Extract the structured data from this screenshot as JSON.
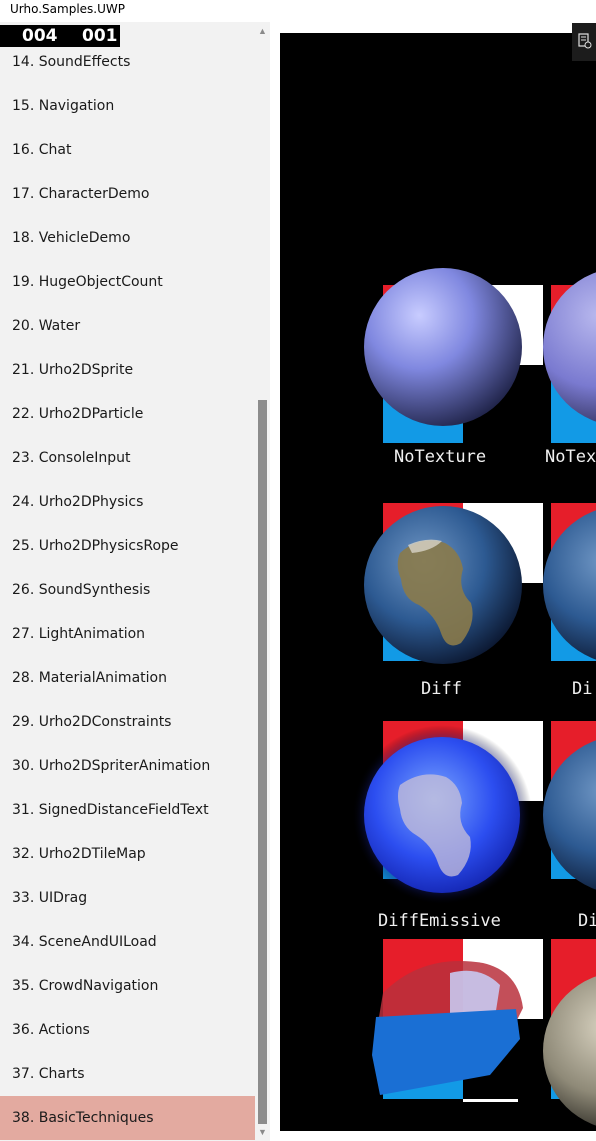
{
  "window": {
    "title": "Urho.Samples.UWP"
  },
  "fps": {
    "left": "004",
    "right": "001"
  },
  "samples": [
    "14. SoundEffects",
    "15. Navigation",
    "16. Chat",
    "17. CharacterDemo",
    "18. VehicleDemo",
    "19. HugeObjectCount",
    "20. Water",
    "21. Urho2DSprite",
    "22. Urho2DParticle",
    "23. ConsoleInput",
    "24. Urho2DPhysics",
    "25. Urho2DPhysicsRope",
    "26. SoundSynthesis",
    "27. LightAnimation",
    "28. MaterialAnimation",
    "29. Urho2DConstraints",
    "30. Urho2DSpriterAnimation",
    "31. SignedDistanceFieldText",
    "32. Urho2DTileMap",
    "33. UIDrag",
    "34. SceneAndUILoad",
    "35. CrowdNavigation",
    "36. Actions",
    "37. Charts",
    "38. BasicTechniques"
  ],
  "selected_index": 24,
  "scene": {
    "labels": [
      "NoTexture",
      "NoTex",
      "Diff",
      "Di",
      "DiffEmissive",
      "Di"
    ]
  },
  "colors": {
    "selected_bg": "#e3aaa0",
    "sidebar_bg": "#f2f2f2",
    "viewport_bg": "#000000"
  },
  "icons": {
    "corner": "debug-overlay-icon",
    "scroll_up": "chevron-up-icon",
    "scroll_down": "chevron-down-icon"
  }
}
